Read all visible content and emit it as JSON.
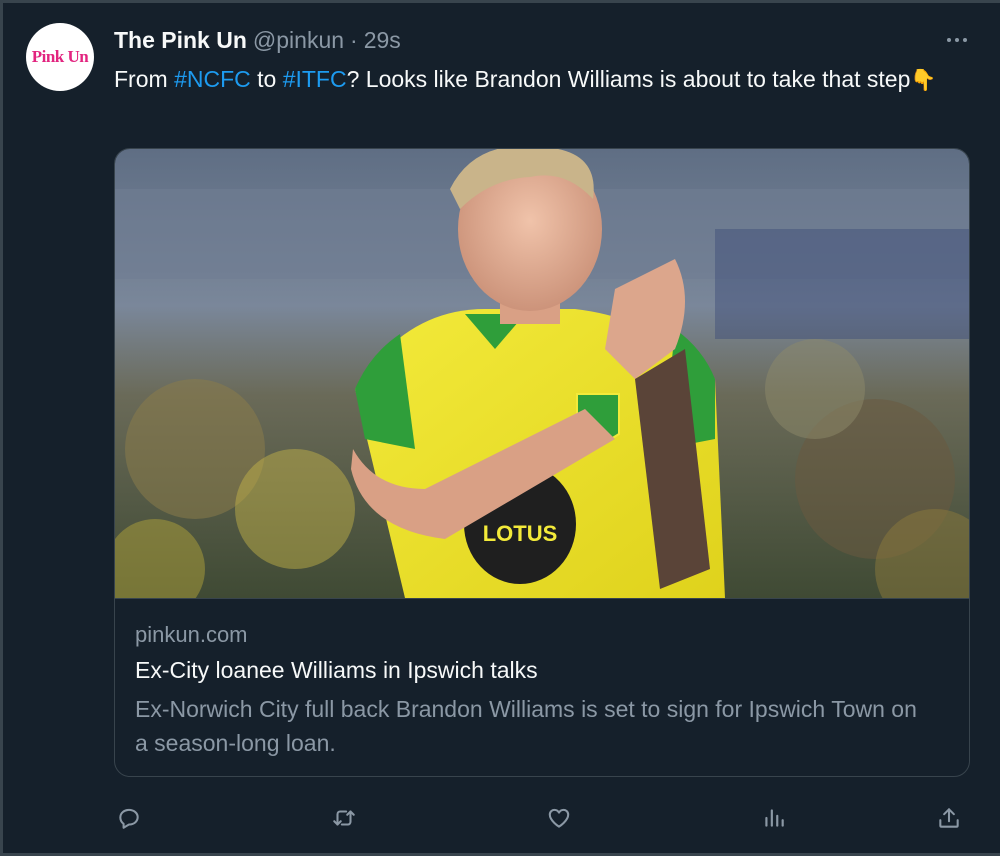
{
  "tweet": {
    "author_name": "The Pink Un",
    "handle": "@pinkun",
    "separator": "·",
    "time": "29s",
    "avatar_text": "Pink Un",
    "text": {
      "part1": "From ",
      "hashtag1": "#NCFC",
      "part2": " to ",
      "hashtag2": "#ITFC",
      "part3": "? Looks like Brandon Williams is about to take that step",
      "emoji": "👇"
    }
  },
  "card": {
    "domain": "pinkun.com",
    "title": "Ex-City loanee Williams in Ipswich talks",
    "description": "Ex-Norwich City full back Brandon Williams is set to sign for Ipswich Town on a season-long loan.",
    "image_shirt_sponsor": "LOTUS"
  },
  "actions": [
    {
      "name": "reply",
      "icon": "reply-icon"
    },
    {
      "name": "retweet",
      "icon": "retweet-icon"
    },
    {
      "name": "like",
      "icon": "heart-icon"
    },
    {
      "name": "views",
      "icon": "views-icon"
    },
    {
      "name": "share",
      "icon": "share-icon"
    }
  ],
  "colors": {
    "background": "#15202b",
    "text": "#f7f9f9",
    "muted": "#8b98a5",
    "link": "#1d9bf0",
    "border": "#38444d",
    "avatar_brand": "#e2247f"
  }
}
